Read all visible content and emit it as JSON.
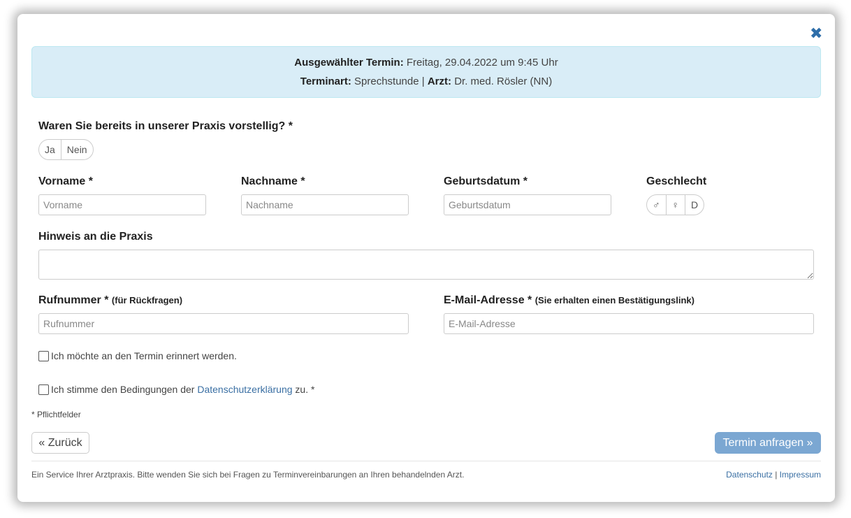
{
  "header": {
    "close_icon": "close-icon",
    "selected_label": "Ausgewählter Termin:",
    "selected_value": "Freitag, 29.04.2022 um 9:45 Uhr",
    "type_label": "Terminart:",
    "type_value": "Sprechstunde",
    "separator": "|",
    "doctor_label": "Arzt:",
    "doctor_value": "Dr. med. Rösler (NN)"
  },
  "visited": {
    "question": "Waren Sie bereits in unserer Praxis vorstellig? *",
    "options": [
      "Ja",
      "Nein"
    ]
  },
  "fields": {
    "firstname": {
      "label": "Vorname *",
      "placeholder": "Vorname"
    },
    "lastname": {
      "label": "Nachname *",
      "placeholder": "Nachname"
    },
    "birthdate": {
      "label": "Geburtsdatum *",
      "placeholder": "Geburtsdatum"
    },
    "gender": {
      "label": "Geschlecht",
      "options": [
        "♂",
        "♀",
        "D"
      ]
    },
    "note": {
      "label": "Hinweis an die Praxis",
      "placeholder": ""
    },
    "phone": {
      "label": "Rufnummer *",
      "hint": "(für Rückfragen)",
      "placeholder": "Rufnummer"
    },
    "email": {
      "label": "E-Mail-Adresse *",
      "hint": "(Sie erhalten einen Bestätigungslink)",
      "placeholder": "E-Mail-Adresse"
    }
  },
  "checkboxes": {
    "reminder": "Ich möchte an den Termin erinnert werden.",
    "privacy_before": "Ich stimme den Bedingungen der ",
    "privacy_link": "Datenschutzerklärung",
    "privacy_after": " zu. *"
  },
  "required_note": "* Pflichtfelder",
  "buttons": {
    "back": "« Zurück",
    "submit": "Termin anfragen »"
  },
  "footer": {
    "text": "Ein Service Ihrer Arztpraxis. Bitte wenden Sie sich bei Fragen zu Terminvereinbarungen an Ihren behandelnden Arzt.",
    "link_privacy": "Datenschutz",
    "separator": "|",
    "link_imprint": "Impressum"
  },
  "colors": {
    "accent": "#2e6ea9",
    "info_bg": "#d9edf7",
    "submit_bg": "#7ba7d2"
  }
}
